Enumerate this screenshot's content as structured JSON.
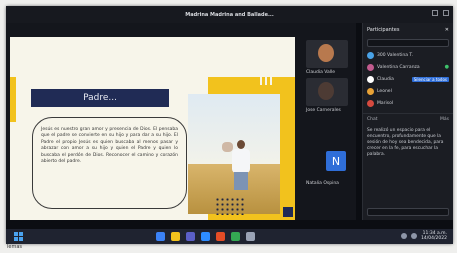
{
  "window": {
    "title": "Madrina Madrina and Ballade...",
    "left_label": "Participantes"
  },
  "slide": {
    "title": "Padre...",
    "body": "Jesús es nuestro gran amor y presencia de Dios. El pensaba que el padre se convierte en su hijo y para dar a su hijo. El Padre el propio Jesús es quien buscaba al menos pasar y abrazar con amor a su hijo y quien el Padre y quien lo buscaba el perdón de Dios. Reconocer el camino y corazón abierto del padre."
  },
  "tiles": [
    {
      "name": "Claudia Valle",
      "color": "#b8794e"
    },
    {
      "name": "Jose Carnerales",
      "color": "#4d3b34"
    },
    {
      "name": "Natalia Ospina",
      "avatar": "N"
    }
  ],
  "sidebar": {
    "header": "Participantes",
    "people": [
      {
        "name": "300 Valentina T.",
        "color": "#49a2e6"
      },
      {
        "name": "Valentina Carranza",
        "color": "#c25b8e",
        "mute": "",
        "icon": "mic-icon"
      },
      {
        "name": "Claudia",
        "color": "#ffffff",
        "mute": "Silenciar a todos",
        "icon": "video-icon"
      },
      {
        "name": "Leonel",
        "color": "#e8a236"
      },
      {
        "name": "Marisol",
        "color": "#d64a3f"
      }
    ],
    "section": "Chat",
    "section_right": "Más",
    "chat": "Se realizó un espacio para el encuentro, profundamente que la sesión de hoy sea bendecida, para crecer en la fe, para escuchar la palabra."
  },
  "taskbar": {
    "time": "11:34 a.m.",
    "date": "14/04/2022",
    "left": "lemas"
  }
}
